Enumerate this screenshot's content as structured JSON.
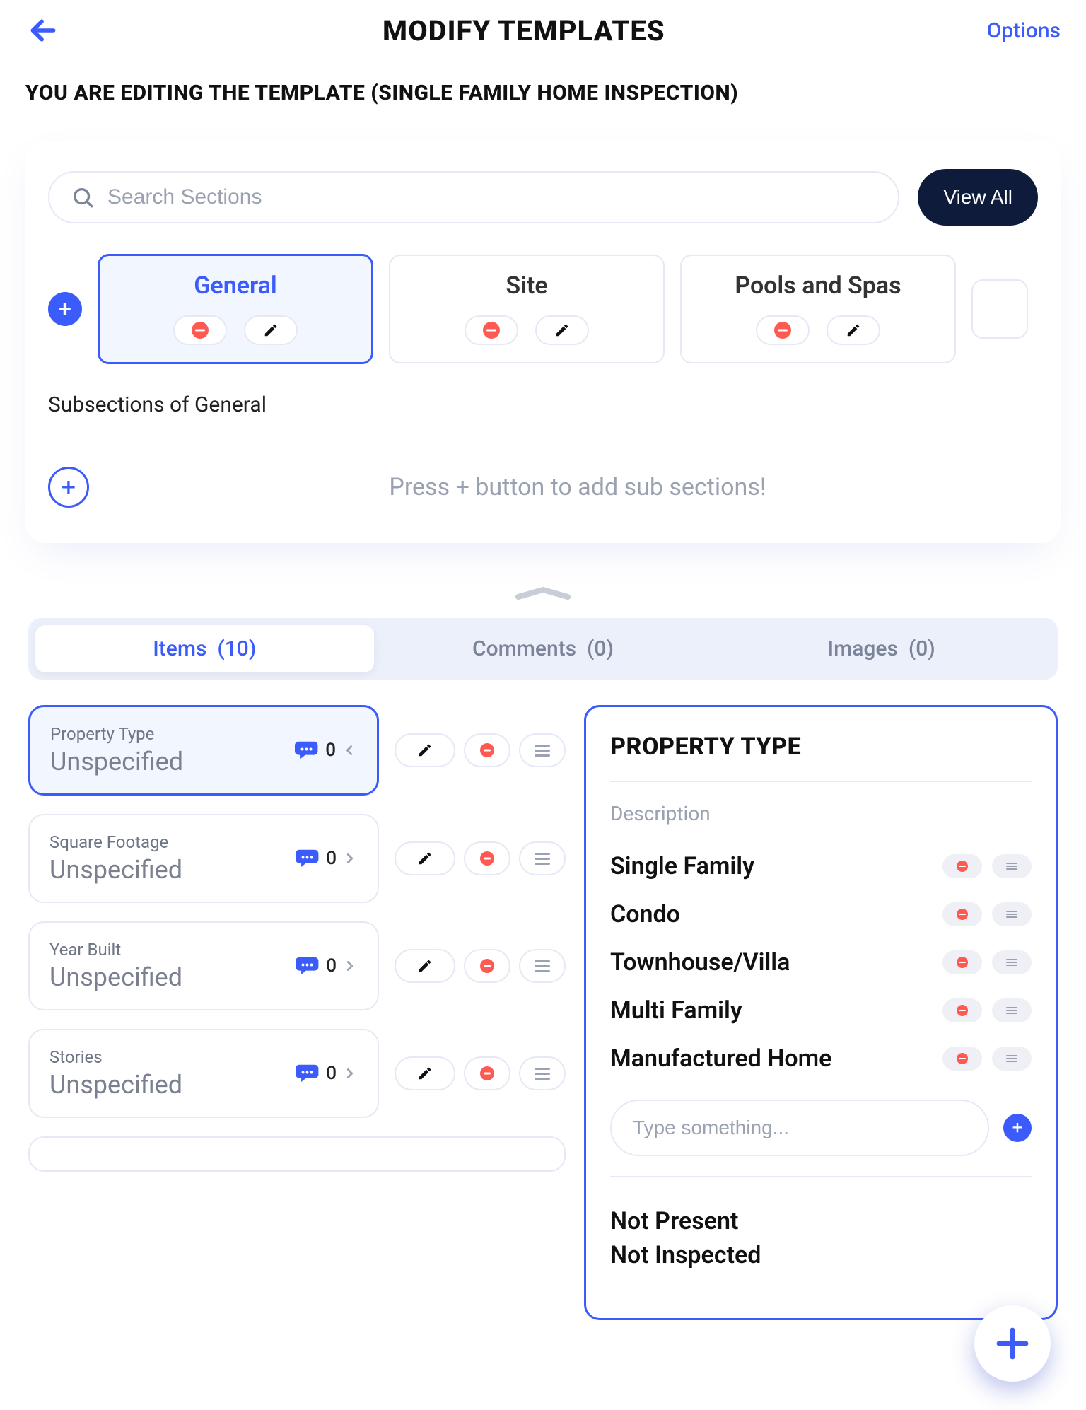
{
  "header": {
    "title": "MODIFY TEMPLATES",
    "options": "Options"
  },
  "subheader": "YOU ARE EDITING THE TEMPLATE (SINGLE FAMILY HOME INSPECTION)",
  "search": {
    "placeholder": "Search Sections",
    "view_all": "View All"
  },
  "sections": [
    {
      "name": "General",
      "active": true
    },
    {
      "name": "Site",
      "active": false
    },
    {
      "name": "Pools and Spas",
      "active": false
    }
  ],
  "subsections": {
    "title": "Subsections of General",
    "hint": "Press + button to add sub sections!"
  },
  "tabs": {
    "items": {
      "label": "Items",
      "count": 10
    },
    "comments": {
      "label": "Comments",
      "count": 0
    },
    "images": {
      "label": "Images",
      "count": 0
    }
  },
  "items": [
    {
      "label": "Property Type",
      "value": "Unspecified",
      "bubble": 0,
      "active": true
    },
    {
      "label": "Square Footage",
      "value": "Unspecified",
      "bubble": 0,
      "active": false
    },
    {
      "label": "Year Built",
      "value": "Unspecified",
      "bubble": 0,
      "active": false
    },
    {
      "label": "Stories",
      "value": "Unspecified",
      "bubble": 0,
      "active": false
    }
  ],
  "detail": {
    "title": "PROPERTY TYPE",
    "description_label": "Description",
    "options": [
      "Single Family",
      "Condo",
      "Townhouse/Villa",
      "Multi Family",
      "Manufactured Home"
    ],
    "type_placeholder": "Type something...",
    "extras": [
      "Not Present",
      "Not Inspected"
    ]
  }
}
